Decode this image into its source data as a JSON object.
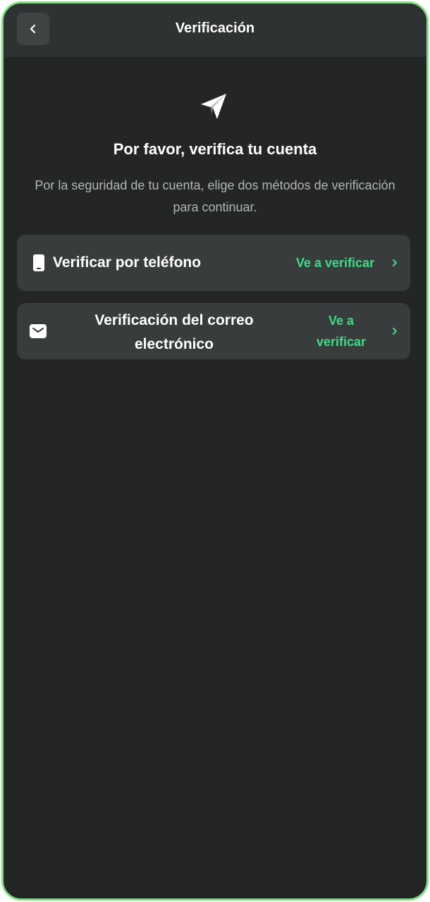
{
  "header": {
    "title": "Verificación",
    "back_icon": "chevron-left-icon"
  },
  "hero": {
    "icon": "paper-plane-icon",
    "title": "Por favor, verifica tu cuenta",
    "subtitle": "Por la seguridad de tu cuenta, elige dos métodos de verificación para continuar."
  },
  "options": [
    {
      "icon": "phone-icon",
      "label": "Verificar por teléfono",
      "action": "Ve a verificar",
      "chevron": "chevron-right-icon"
    },
    {
      "icon": "mail-icon",
      "label": "Verificación del correo electrónico",
      "action": "Ve a verificar",
      "chevron": "chevron-right-icon"
    }
  ],
  "colors": {
    "background": "#242626",
    "header": "#2f3232",
    "card": "#393c3c",
    "accent": "#3ddc84",
    "frame": "#7de07d"
  }
}
